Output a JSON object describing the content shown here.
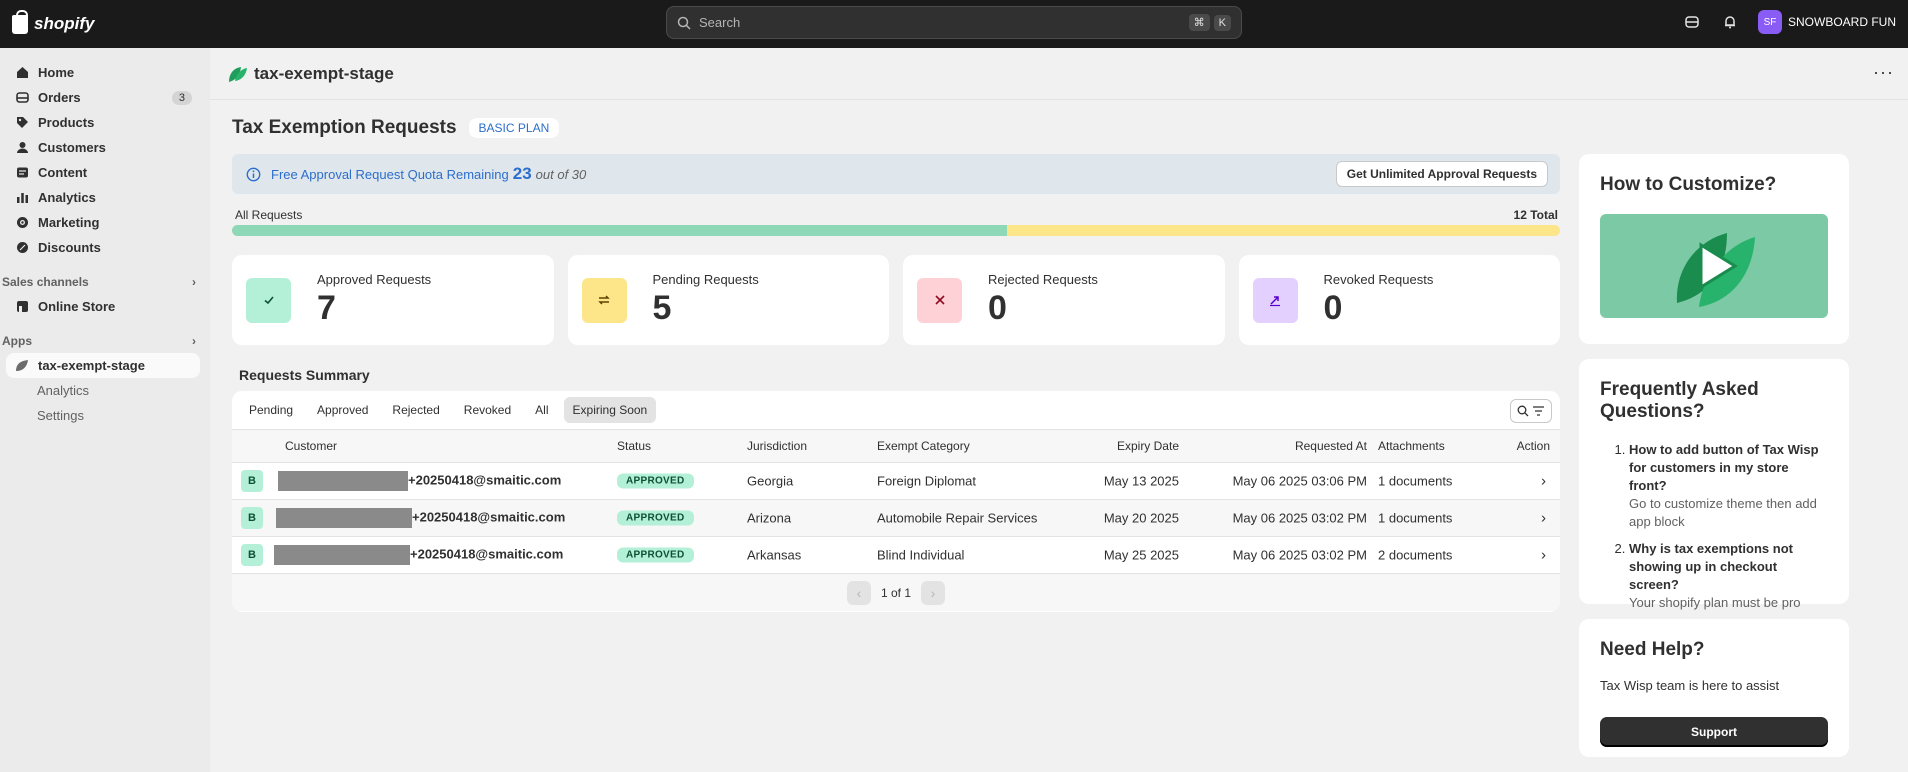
{
  "topbar": {
    "brand": "shopify",
    "search_placeholder": "Search",
    "shortcut_keys": [
      "⌘",
      "K"
    ],
    "store_initials": "SF",
    "store_name": "SNOWBOARD FUN"
  },
  "sidebar": {
    "items": [
      {
        "label": "Home",
        "icon": "home-icon"
      },
      {
        "label": "Orders",
        "icon": "orders-icon",
        "badge": "3"
      },
      {
        "label": "Products",
        "icon": "tag-icon"
      },
      {
        "label": "Customers",
        "icon": "person-icon"
      },
      {
        "label": "Content",
        "icon": "content-icon"
      },
      {
        "label": "Analytics",
        "icon": "bar-chart-icon"
      },
      {
        "label": "Marketing",
        "icon": "target-icon"
      },
      {
        "label": "Discounts",
        "icon": "discount-icon"
      }
    ],
    "sales_channels_label": "Sales channels",
    "online_store": "Online Store",
    "apps_label": "Apps",
    "app_name": "tax-exempt-stage",
    "app_subitems": [
      "Analytics",
      "Settings"
    ]
  },
  "header": {
    "app_title": "tax-exempt-stage",
    "more": "···"
  },
  "page": {
    "title": "Tax Exemption Requests",
    "plan_badge": "BASIC PLAN"
  },
  "quota": {
    "text": "Free Approval Request Quota Remaining",
    "remaining": "23",
    "out_of": "out of 30",
    "button": "Get Unlimited Approval Requests"
  },
  "progress": {
    "label": "All Requests",
    "total": "12 Total",
    "approved_fraction": 0.5833
  },
  "stats": [
    {
      "label": "Approved Requests",
      "value": "7",
      "icon": "check-icon",
      "bg": "#b4efd8",
      "fg": "#0c5132"
    },
    {
      "label": "Pending Requests",
      "value": "5",
      "icon": "refresh-icon",
      "bg": "#fde68a",
      "fg": "#5e4200"
    },
    {
      "label": "Rejected Requests",
      "value": "0",
      "icon": "x-icon",
      "bg": "#fed1d7",
      "fg": "#8e0b21"
    },
    {
      "label": "Revoked Requests",
      "value": "0",
      "icon": "revoke-icon",
      "bg": "#e3d0ff",
      "fg": "#5700d1"
    }
  ],
  "summary": {
    "title": "Requests Summary",
    "tabs": [
      "Pending",
      "Approved",
      "Rejected",
      "Revoked",
      "All",
      "Expiring Soon"
    ],
    "active_tab": "Expiring Soon",
    "columns": [
      "Customer",
      "Status",
      "Jurisdiction",
      "Exempt Category",
      "Expiry Date",
      "Requested At",
      "Attachments",
      "Action"
    ],
    "rows": [
      {
        "avatar": "B",
        "email": "+20250418@smaitic.com",
        "status": "APPROVED",
        "jurisdiction": "Georgia",
        "category": "Foreign Diplomat",
        "expiry": "May 13 2025",
        "requested": "May 06 2025 03:06 PM",
        "attachments": "1 documents"
      },
      {
        "avatar": "B",
        "email": "+20250418@smaitic.com",
        "status": "APPROVED",
        "jurisdiction": "Arizona",
        "category": "Automobile Repair Services",
        "expiry": "May 20 2025",
        "requested": "May 06 2025 03:02 PM",
        "attachments": "1 documents"
      },
      {
        "avatar": "B",
        "email": "+20250418@smaitic.com",
        "status": "APPROVED",
        "jurisdiction": "Arkansas",
        "category": "Blind Individual",
        "expiry": "May 25 2025",
        "requested": "May 06 2025 03:02 PM",
        "attachments": "2 documents"
      }
    ],
    "pagination": "1 of 1"
  },
  "customize": {
    "title": "How to Customize?"
  },
  "faq": {
    "title": "Frequently Asked Questions?",
    "items": [
      {
        "q": "How to add button of Tax Wisp for customers in my store front?",
        "a": "Go to customize theme then add app block"
      },
      {
        "q": "Why is tax exemptions not showing up in checkout screen?",
        "a": "Your shopify plan must be pro"
      }
    ]
  },
  "help": {
    "title": "Need Help?",
    "text": "Tax Wisp team is here to assist",
    "button": "Support"
  }
}
